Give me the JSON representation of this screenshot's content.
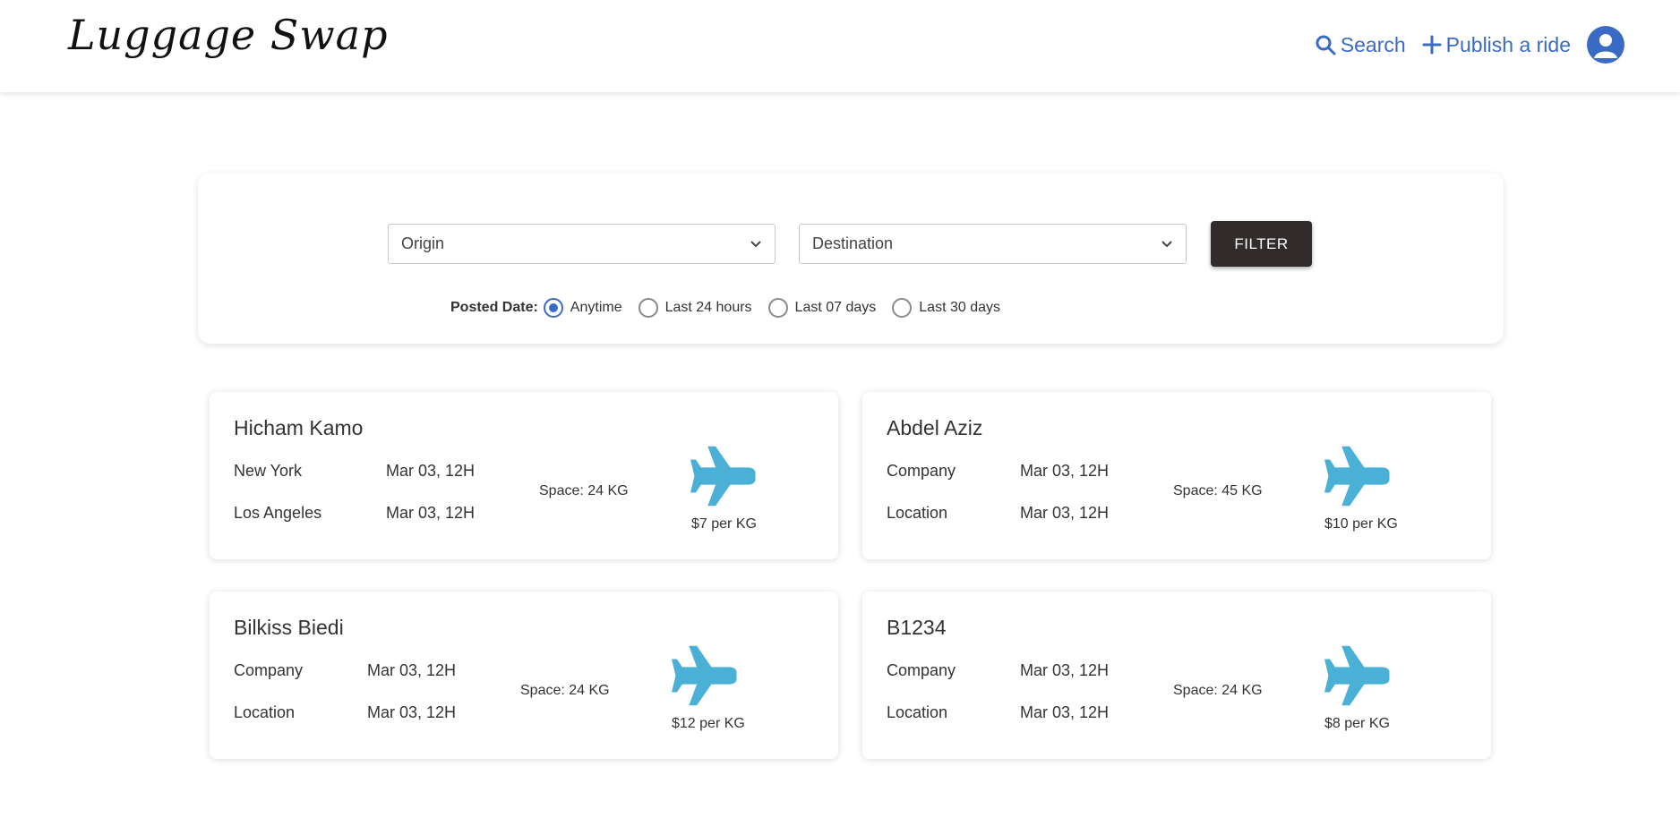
{
  "header": {
    "logo": "Luggage Swap",
    "search_label": "Search",
    "publish_label": "Publish a ride",
    "icons": {
      "search": "search-icon",
      "publish": "plus-icon",
      "avatar": "user-avatar-icon"
    }
  },
  "filter": {
    "origin_placeholder": "Origin",
    "destination_placeholder": "Destination",
    "button_label": "FILTER",
    "posted_date_label": "Posted Date:",
    "options": [
      "Anytime",
      "Last 24 hours",
      "Last 07 days",
      "Last 30 days"
    ],
    "selected": "Anytime"
  },
  "rides": [
    {
      "name": "Hicham Kamo",
      "row1_label": "New York",
      "row1_date": "Mar 03, 12H",
      "row2_label": "Los Angeles",
      "row2_date": "Mar 03, 12H",
      "space": "Space: 24 KG",
      "price": "$7 per KG"
    },
    {
      "name": "Abdel Aziz",
      "row1_label": "Company",
      "row1_date": "Mar 03, 12H",
      "row2_label": "Location",
      "row2_date": "Mar 03, 12H",
      "space": "Space: 45 KG",
      "price": "$10 per KG"
    },
    {
      "name": "Bilkiss Biedi",
      "row1_label": "Company",
      "row1_date": "Mar 03, 12H",
      "row2_label": "Location",
      "row2_date": "Mar 03, 12H",
      "space": "Space: 24 KG",
      "price": "$12 per KG"
    },
    {
      "name": "B1234",
      "row1_label": "Company",
      "row1_date": "Mar 03, 12H",
      "row2_label": "Location",
      "row2_date": "Mar 03, 12H",
      "space": "Space: 24 KG",
      "price": "$8 per KG"
    }
  ],
  "colors": {
    "accent": "#3a6bc4",
    "plane": "#4bb0d6",
    "button": "#322b2b"
  }
}
